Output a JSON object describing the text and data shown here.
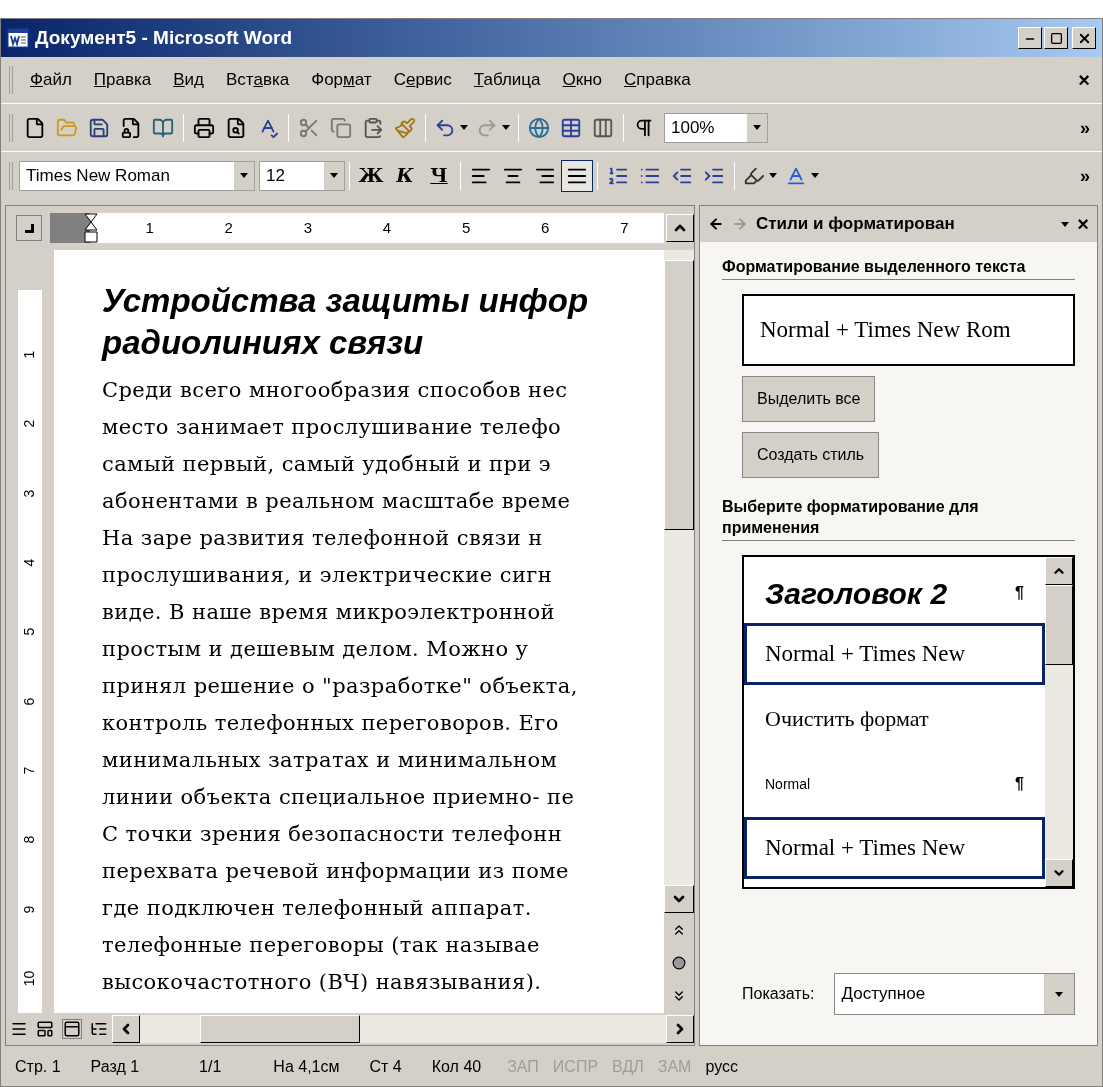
{
  "window": {
    "title": "Документ5 - Microsoft Word"
  },
  "menu": [
    {
      "key": "Ф",
      "after": "айл"
    },
    {
      "key": "П",
      "after": "равка"
    },
    {
      "key": "В",
      "after": "ид"
    },
    {
      "before": "Вст",
      "key": "а",
      "after": "вка"
    },
    {
      "before": "Фор",
      "key": "м",
      "after": "ат"
    },
    {
      "before": "С",
      "key": "е",
      "after": "рвис"
    },
    {
      "key": "Т",
      "after": "аблица"
    },
    {
      "key": "О",
      "after": "кно"
    },
    {
      "key": "С",
      "after": "правка"
    }
  ],
  "menu_close": "×",
  "toolbar": {
    "zoom": "100%",
    "overflow": "»"
  },
  "format_bar": {
    "font": "Times New Roman",
    "size": "12",
    "styles": [
      "Ж",
      "К",
      "Ч"
    ],
    "align_buttons": [
      {
        "selected": false
      },
      {
        "selected": false
      },
      {
        "selected": false
      },
      {
        "selected": true
      }
    ],
    "overflow": "»"
  },
  "ruler": {
    "numbers": [
      "1",
      "2",
      "3",
      "4",
      "5",
      "6",
      "7"
    ],
    "vertical_numbers": [
      "1",
      "2",
      "3",
      "4",
      "5",
      "6",
      "7",
      "8",
      "9",
      "10"
    ]
  },
  "document": {
    "heading": [
      "Устройства защиты инфор",
      "радиолиниях связи"
    ],
    "lines": [
      "Среди всего многообразия способов нес",
      "место занимает прослушивание телефо",
      "самый первый, самый удобный и при э",
      "абонентами в реальном масштабе време",
      "На заре развития телефонной связи н",
      "прослушивания, и электрические сигн",
      "виде. В наше время микроэлектронной",
      "простым и дешевым делом. Можно у",
      "принял решение о \"разработке\" объекта,",
      "контроль телефонных переговоров. Его",
      "минимальных затратах и минимальном",
      "линии объекта специальное приемно- пе",
      "С точки зрения безопасности телефонн",
      "перехвата речевой информации из поме",
      "где подключен телефонный аппарат.",
      "телефонные переговоры (так называе",
      "высокочастотного (ВЧ) навязывания)."
    ]
  },
  "task_pane": {
    "title": "Стили и форматирован",
    "close": "×",
    "selected_heading": "Форматирование выделенного текста",
    "current_format": "Normal + Times New Rom",
    "buttons": [
      "Выделить все",
      "Создать стиль"
    ],
    "apply_heading": "Выберите форматирование для применения",
    "styles": [
      {
        "kind": "heading",
        "label": "Заголовок 2",
        "mark": "¶",
        "selected": false
      },
      {
        "kind": "format",
        "label": "Normal + Times New",
        "selected": true
      },
      {
        "kind": "clear",
        "label": "Очистить формат",
        "selected": false
      },
      {
        "kind": "small",
        "label": "Normal",
        "mark": "¶",
        "selected": false
      },
      {
        "kind": "format",
        "label": "Normal + Times New",
        "selected": true
      }
    ],
    "show_label": "Показать:",
    "show_value": "Доступное"
  },
  "status_bar": {
    "fields": [
      "Стр. 1",
      "Разд 1",
      "1/1",
      "На 4,1см",
      "Ст 4",
      "Кол 40"
    ],
    "modes": [
      {
        "label": "ЗАП",
        "disabled": true
      },
      {
        "label": "ИСПР",
        "disabled": true
      },
      {
        "label": "ВДЛ",
        "disabled": true
      },
      {
        "label": "ЗАМ",
        "disabled": true
      }
    ],
    "language": "русс"
  }
}
